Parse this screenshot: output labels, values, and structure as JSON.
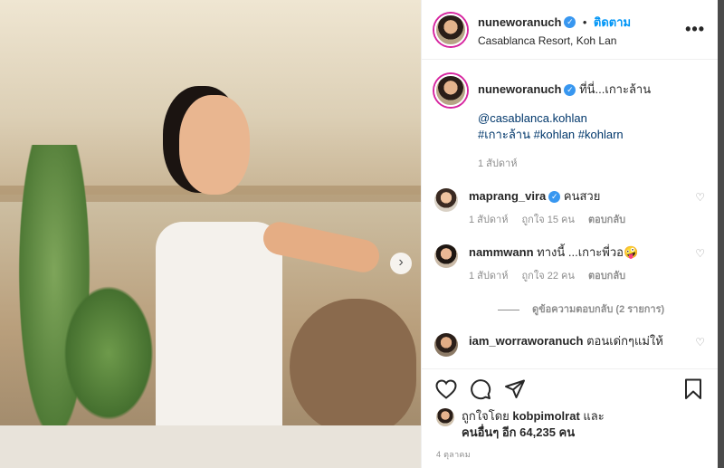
{
  "post": {
    "username": "nuneworanuch",
    "follow_label": "ติดตาม",
    "location": "Casablanca Resort, Koh Lan",
    "more_label": "•••",
    "next_label": "›"
  },
  "caption": {
    "username": "nuneworanuch",
    "text": "ที่นี่...เกาะล้าน",
    "mention": "@casablanca.kohlan",
    "hashtags": [
      "#เกาะล้าน",
      "#kohlan",
      "#kohlarn"
    ],
    "time": "1 สัปดาห์"
  },
  "comments": [
    {
      "username": "maprang_vira",
      "verified": true,
      "text": "คนสวย",
      "time": "1 สัปดาห์",
      "likes": "ถูกใจ 15 คน",
      "reply": "ตอบกลับ"
    },
    {
      "username": "nammwann",
      "verified": false,
      "text": "ทางนี้ ...เกาะพี่วอ🤪",
      "time": "1 สัปดาห์",
      "likes": "ถูกใจ 22 คน",
      "reply": "ตอบกลับ"
    },
    {
      "username": "iam_worraworanuch",
      "verified": false,
      "text": "ตอนเด่กๆแม่ให้"
    }
  ],
  "view_replies": "ดูข้อความตอบกลับ (2 รายการ)",
  "likes_line": {
    "prefix": "ถูกใจโดย",
    "user": "kobpimolrat",
    "and": "และ",
    "others": "คนอื่นๆ อีก 64,235 คน"
  },
  "date": "4 ตุลาคม"
}
